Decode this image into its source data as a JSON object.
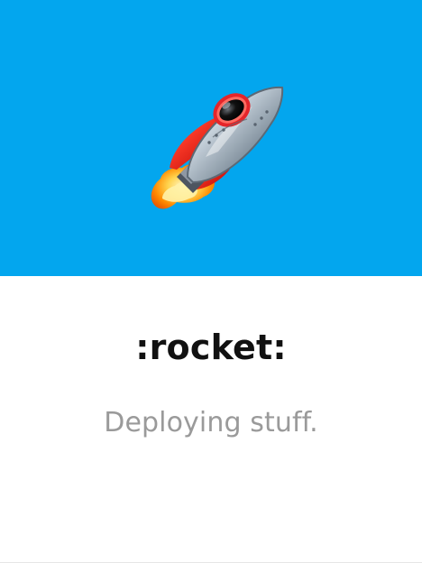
{
  "card": {
    "hero": {
      "background_color": "#03A6EE",
      "icon": "rocket-icon"
    },
    "title": ":rocket:",
    "subtitle": "Deploying stuff."
  }
}
